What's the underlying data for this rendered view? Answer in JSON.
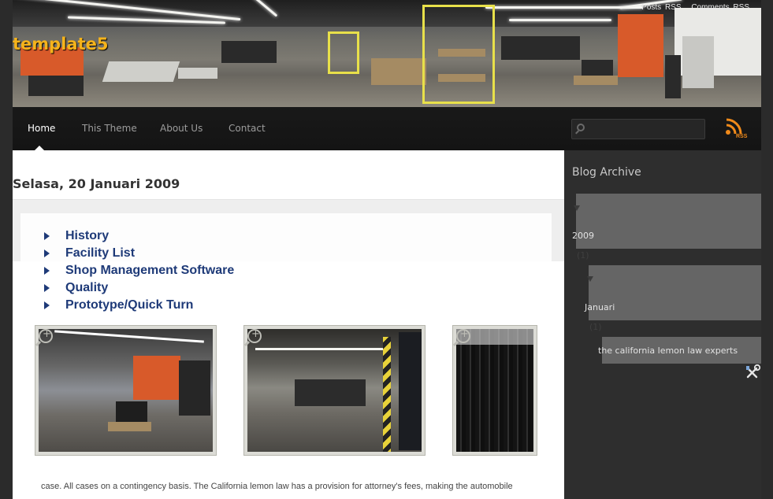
{
  "site": {
    "title": "template5",
    "top_links": [
      "Posts RSS",
      "Comments RSS"
    ]
  },
  "nav": {
    "tabs": [
      {
        "label": "Home",
        "active": true
      },
      {
        "label": "This Theme",
        "active": false
      },
      {
        "label": "About Us",
        "active": false
      },
      {
        "label": "Contact",
        "active": false
      }
    ],
    "search": {
      "placeholder": "",
      "icon": "search-icon"
    },
    "rss": {
      "label": "RSS",
      "icon": "rss-feed-icon"
    }
  },
  "post": {
    "date": "Selasa, 20 Januari 2009",
    "menu": [
      "History",
      "Facility List",
      "Shop Management Software",
      "Quality",
      "Prototype/Quick Turn"
    ],
    "thumbnails": [
      {
        "icon": "zoom-in-icon"
      },
      {
        "icon": "zoom-in-icon"
      },
      {
        "icon": "zoom-in-icon"
      }
    ],
    "body": "case. All cases on a contingency basis. The California lemon law has a provision for attorney's fees, making the automobile"
  },
  "sidebar": {
    "title": "Blog Archive",
    "year": {
      "label": "2009",
      "count": "(1)"
    },
    "month": {
      "label": "Januari",
      "count": "(1)"
    },
    "post_link": "the california lemon law experts"
  },
  "colors": {
    "accent": "#f5b31b",
    "menu_link": "#1e3a78",
    "nav_bg": "#141414",
    "sidebar_block": "#656565"
  }
}
